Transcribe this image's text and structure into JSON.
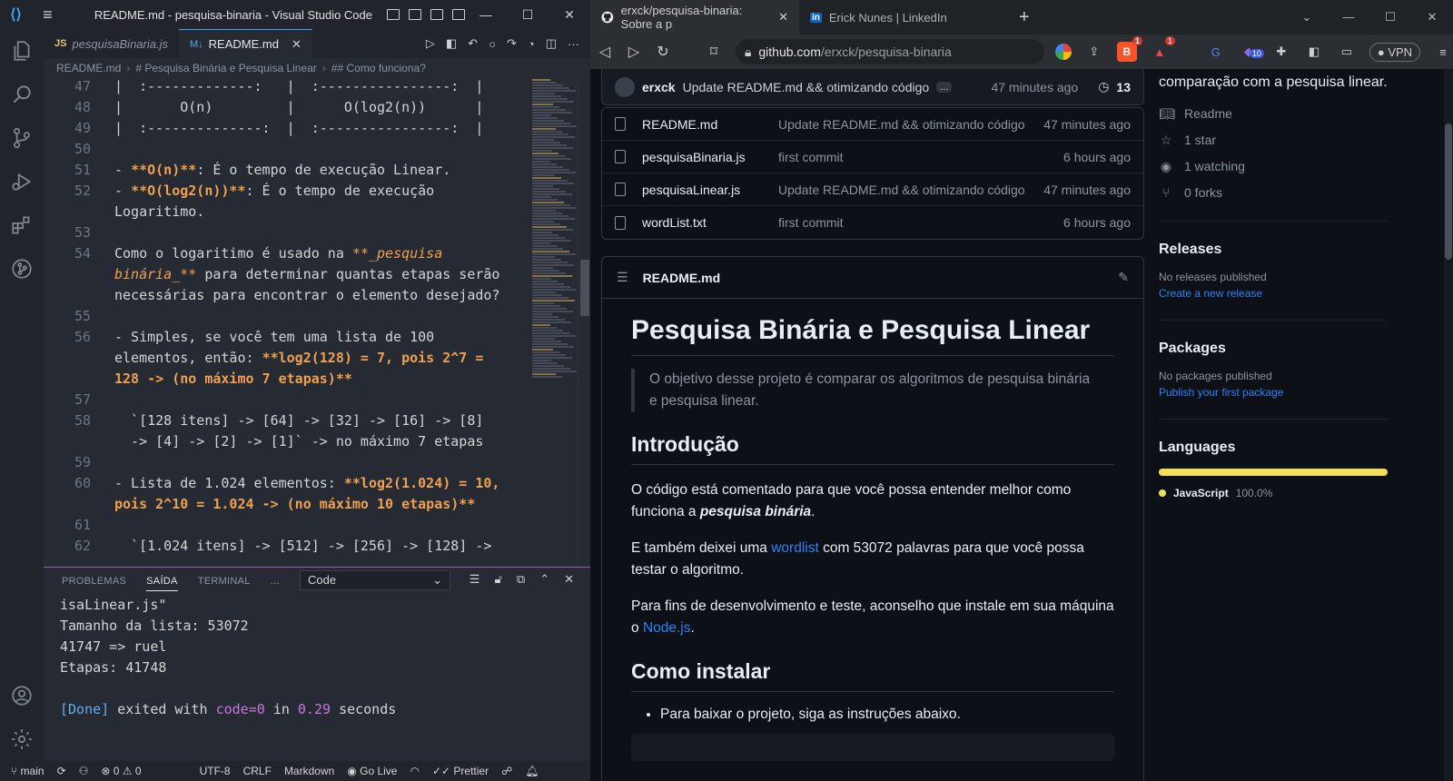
{
  "vscode": {
    "window_title": "README.md - pesquisa-binaria - Visual Studio Code",
    "tabs": [
      {
        "badge": "JS",
        "label": "pesquisaBinaria.js"
      },
      {
        "badge": "M↓",
        "label": "README.md"
      }
    ],
    "breadcrumb": [
      "README.md",
      "# Pesquisa Binária e Pesquisa Linear",
      "## Como funciona?"
    ],
    "lines": [
      {
        "num": "47",
        "text": "|  :-------------:   |  :----------------:  |"
      },
      {
        "num": "48",
        "text": "|       O(n)         |      O(log2(n))      |"
      },
      {
        "num": "49",
        "text": "|  :--------------:  |  :----------------:  |"
      },
      {
        "num": "50",
        "text": ""
      },
      {
        "num": "51",
        "a": "- ",
        "b": "**O(n)**",
        "c": ": É o tempo de execução Linear."
      },
      {
        "num": "52",
        "a": "- ",
        "b": "**O(log2(n))**",
        "c": ": É o tempo de execução",
        "d": "Logaritimo."
      },
      {
        "num": "53",
        "text": ""
      },
      {
        "num": "54",
        "a": "Como o logaritimo é usado na ",
        "b": "**_pesquisa",
        "b2": "binária_**",
        "c": " para determinar quantas etapas serão",
        "d": "necessárias para encontrar o elemento desejado?"
      },
      {
        "num": "55",
        "text": ""
      },
      {
        "num": "56",
        "a": "- Simples, se você tem uma lista de 100",
        "b1": "elementos, então: ",
        "b": "**log2(128) = 7, pois 2^7 =",
        "b2": "128 -> (no máximo 7 etapas)**"
      },
      {
        "num": "57",
        "text": ""
      },
      {
        "num": "58",
        "a": "  `[128 itens] -> [64] -> [32] -> [16] -> [8]",
        "b": "  -> [4] -> [2] -> [1]` -> no máximo 7 etapas"
      },
      {
        "num": "59",
        "text": ""
      },
      {
        "num": "60",
        "a": "- Lista de 1.024 elementos: ",
        "b": "**log2(1.024) = 10,",
        "b2": "pois 2^10 = 1.024 -> (no máximo 10 etapas)**"
      },
      {
        "num": "61",
        "text": ""
      },
      {
        "num": "62",
        "a": "  `[1.024 itens] -> [512] -> [256] -> [128] ->"
      }
    ],
    "panel": {
      "tabs": [
        "PROBLEMAS",
        "SAÍDA",
        "TERMINAL",
        "..."
      ],
      "select": "Code",
      "output": [
        "isaLinear.js\"",
        "Tamanho da lista: 53072",
        "41747 => ruel",
        "Etapas: 41748",
        "",
        "[Done] exited with code=0 in 0.29 seconds"
      ],
      "done_parts": [
        "[Done]",
        "exited with",
        "code=0",
        "in",
        "0.29",
        "seconds"
      ]
    },
    "status": {
      "branch": "main",
      "errors": "0",
      "warnings": "0",
      "encoding": "UTF-8",
      "eol": "CRLF",
      "language": "Markdown",
      "golive": "Go Live",
      "prettier": "Prettier"
    }
  },
  "browser": {
    "tabs": [
      {
        "label": "erxck/pesquisa-binaria: Sobre a p",
        "icon": "github-icon"
      },
      {
        "label": "Erick Nunes | LinkedIn",
        "icon": "linkedin-icon",
        "icon_text": "in"
      }
    ],
    "url_host": "github.com",
    "url_path": "/erxck/pesquisa-binaria",
    "brave_badge": "1",
    "alert_badge": "1",
    "ext_badge": "10",
    "vpn": "VPN"
  },
  "github": {
    "commit": {
      "author": "erxck",
      "message": "Update README.md && otimizando código",
      "more": "...",
      "time": "47 minutes ago",
      "history_count": "13"
    },
    "files": [
      {
        "name": "README.md",
        "message": "Update README.md && otimizando código",
        "time": "47 minutes ago"
      },
      {
        "name": "pesquisaBinaria.js",
        "message": "first commit",
        "time": "6 hours ago"
      },
      {
        "name": "pesquisaLinear.js",
        "message": "Update README.md && otimizando código",
        "time": "47 minutes ago"
      },
      {
        "name": "wordList.txt",
        "message": "first commit",
        "time": "6 hours ago"
      }
    ],
    "readme": {
      "filename": "README.md",
      "h1": "Pesquisa Binária e Pesquisa Linear",
      "quote": "O objetivo desse projeto é comparar os algoritmos de pesquisa binária e pesquisa linear.",
      "h2_intro": "Introdução",
      "p1_a": "O código está comentado para que você possa entender melhor como funciona a ",
      "p1_b": "pesquisa binária",
      "p1_c": ".",
      "p2_a": "E também deixei uma ",
      "p2_link": "wordlist",
      "p2_b": " com 53072 palavras para que você possa testar o algoritmo.",
      "p3_a": "Para fins de desenvolvimento e teste, aconselho que instale em sua máquina o ",
      "p3_link": "Node.js",
      "p3_b": ".",
      "h2_install": "Como instalar",
      "li1": "Para baixar o projeto, siga as instruções abaixo."
    },
    "sidebar": {
      "about_tail": "comparação com a pesquisa linear.",
      "readme": "Readme",
      "stars": "1 star",
      "watching": "1 watching",
      "forks": "0 forks",
      "releases_title": "Releases",
      "releases_none": "No releases published",
      "releases_link": "Create a new release",
      "packages_title": "Packages",
      "packages_none": "No packages published",
      "packages_link": "Publish your first package",
      "languages_title": "Languages",
      "language": "JavaScript",
      "language_pct": "100.0%",
      "language_share": 1.0,
      "language_color": "#f1e05a"
    }
  }
}
